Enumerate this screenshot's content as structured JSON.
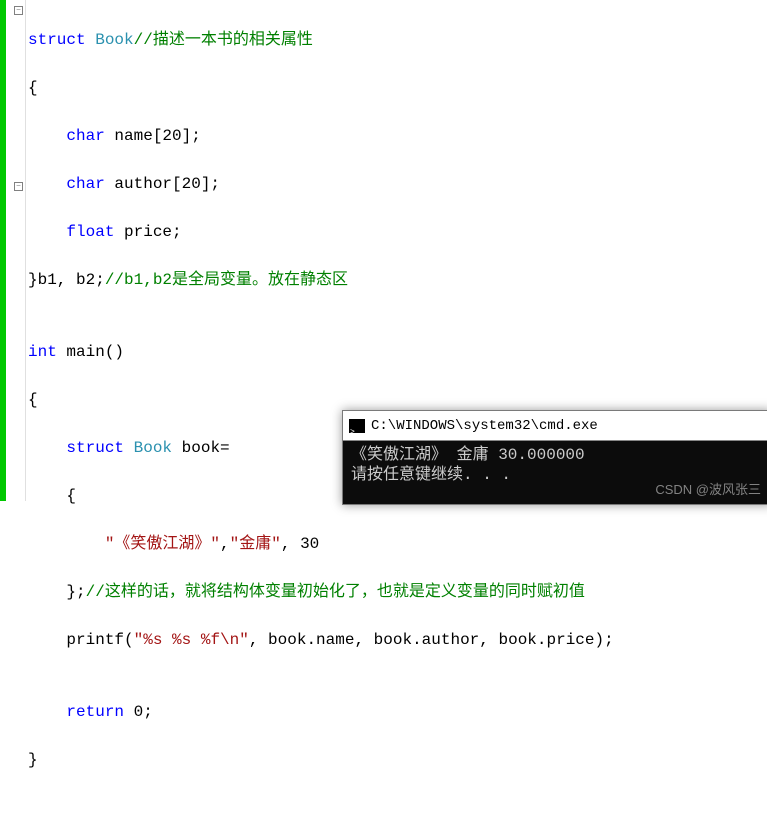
{
  "fold": {
    "minus": "−"
  },
  "code": {
    "l1": {
      "kw": "struct",
      "type": " Book",
      "cmt": "//描述一本书的相关属性"
    },
    "l2": "{",
    "l3": {
      "indent": "    ",
      "kw": "char",
      "rest": " name[20];"
    },
    "l4": {
      "indent": "    ",
      "kw": "char",
      "rest": " author[20];"
    },
    "l5": {
      "indent": "    ",
      "kw": "float",
      "rest": " price;"
    },
    "l6": {
      "text": "}b1, b2;",
      "cmt": "//b1,b2是全局变量。放在静态区"
    },
    "l7": "",
    "l8": {
      "kw": "int",
      "rest": " main()"
    },
    "l9": "{",
    "l10": {
      "indent": "    ",
      "kw": "struct",
      "type": " Book",
      "rest": " book="
    },
    "l11": "    {",
    "l12": {
      "indent": "        ",
      "str": "\"《笑傲江湖》\"",
      "mid": ",",
      "str2": "\"金庸\"",
      "rest": ", 30"
    },
    "l13": {
      "text": "    };",
      "cmt": "//这样的话，就将结构体变量初始化了，也就是定义变量的同时赋初值"
    },
    "l14": {
      "pre": "    printf(",
      "str": "\"%s %s %f\\n\"",
      "rest": ", book.name, book.author, book.price);"
    },
    "l15": "",
    "l16": {
      "indent": "    ",
      "kw": "return",
      "rest": " 0;"
    },
    "l17": "}"
  },
  "terminal": {
    "title": "C:\\WINDOWS\\system32\\cmd.exe",
    "line1": "《笑傲江湖》 金庸 30.000000",
    "line2": "请按任意键继续. . ."
  },
  "watermark": "CSDN @波风张三"
}
